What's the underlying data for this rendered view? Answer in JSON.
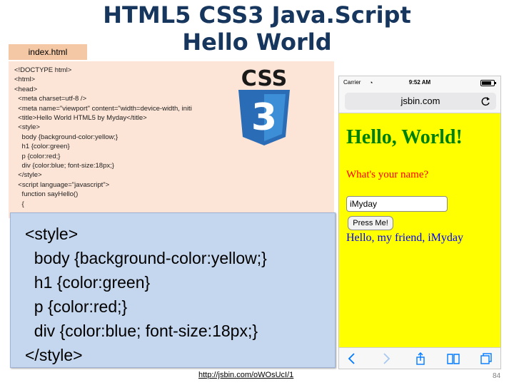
{
  "slide": {
    "title_line1": "HTML5 CSS3 Java.Script",
    "title_line2": "Hello World",
    "file_tab": "index.html",
    "page_number": "84",
    "footer_link": "http://jsbin.com/oWOsUcI/1"
  },
  "code": {
    "lines": [
      "<!DOCTYPE html>",
      "<html>",
      "<head>",
      "  <meta charset=utf-8 />",
      "  <meta name=\"viewport\" content=\"width=device-width, initi",
      "  <title>Hello World HTML5 by Myday</title>",
      "  <style>",
      "    body {background-color:yellow;}",
      "    h1 {color:green}",
      "    p {color:red;}",
      "    div {color:blue; font-size:18px;}",
      "  </style>",
      "  <script language=\"javascript\">",
      "    function sayHello()",
      "    {"
    ]
  },
  "zoom": {
    "lines": [
      "<style>",
      "  body {background-color:yellow;}",
      "  h1 {color:green}",
      "  p {color:red;}",
      "  div {color:blue; font-size:18px;}",
      "</style>"
    ]
  },
  "logo": {
    "text": "CSS",
    "number": "3",
    "colors": {
      "shield": "#2b6cb6",
      "shield_light": "#3c8fd6",
      "text": "#1a1a1a"
    }
  },
  "phone": {
    "carrier": "Carrier",
    "time": "9:52 AM",
    "url": "jsbin.com",
    "heading": "Hello, World!",
    "paragraph": "What's your name?",
    "input_value": "iMyday",
    "button_label": "Press Me!",
    "greeting": "Hello, my friend, iMyday",
    "icons": [
      "back-icon",
      "forward-icon",
      "share-icon",
      "bookmarks-icon",
      "tabs-icon"
    ],
    "colors": {
      "background": "#ffff00",
      "heading": "#008000",
      "paragraph": "#ff0000",
      "greeting": "#0000ff",
      "toolbar_icon": "#007aff"
    }
  },
  "colors": {
    "title": "#17365d",
    "file_tab": "#f4c7a5",
    "code_panel": "#fce4d6",
    "zoom_panel": "#c5d7ef"
  }
}
